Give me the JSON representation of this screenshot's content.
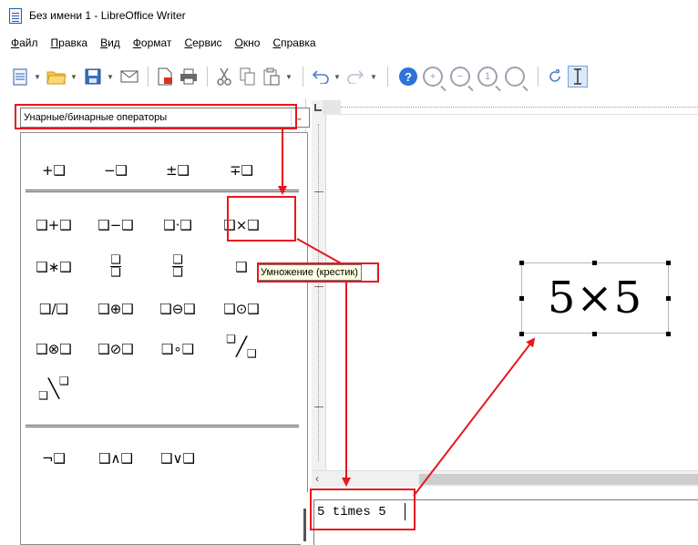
{
  "window": {
    "title": "Без имени 1 - LibreOffice Writer"
  },
  "menu": {
    "items": [
      {
        "underline": "Ф",
        "rest": "айл"
      },
      {
        "underline": "П",
        "rest": "равка"
      },
      {
        "underline": "В",
        "rest": "ид"
      },
      {
        "underline": "Ф",
        "rest": "ормат"
      },
      {
        "underline": "С",
        "rest": "ервис"
      },
      {
        "underline": "О",
        "rest": "кно"
      },
      {
        "underline": "С",
        "rest": "правка"
      }
    ]
  },
  "toolbar": {
    "icons": [
      "new-document-icon",
      "open-icon",
      "save-icon",
      "email-icon",
      "export-pdf-icon",
      "print-icon",
      "cut-icon",
      "copy-icon",
      "paste-icon",
      "undo-icon",
      "redo-icon",
      "help-icon",
      "zoom-in-icon",
      "zoom-out-icon",
      "zoom-100-icon",
      "zoom-fit-icon",
      "update-icon",
      "formula-cursor-icon"
    ],
    "help_glyph": "?",
    "zoom_100_glyph": "1"
  },
  "elements_panel": {
    "category": "Унарные/бинарные операторы",
    "unary": [
      "+❑",
      "−❑",
      "±❑",
      "∓❑"
    ],
    "binary_row1": [
      "❑+❑",
      "❑−❑",
      "❑·❑",
      "❑×❑"
    ],
    "binary_row2_first": "❑∗❑",
    "binary_row2_last": "❑",
    "binary_row3": [
      "❑/❑",
      "❑⊕❑",
      "❑⊖❑",
      "❑⊙❑"
    ],
    "binary_row4": [
      "❑⊗❑",
      "❑⊘❑",
      "❑∘❑"
    ],
    "logic": [
      "¬❑",
      "❑∧❑",
      "❑∨❑"
    ],
    "box_glyph": "❑",
    "slash_glyph": "╱",
    "backslash_glyph": "╲"
  },
  "tooltip": {
    "text": "Умножение (крестик)"
  },
  "document": {
    "formula": "5×5"
  },
  "command": {
    "text": "5 times 5"
  },
  "annotation": {
    "color": "#e8161e"
  }
}
